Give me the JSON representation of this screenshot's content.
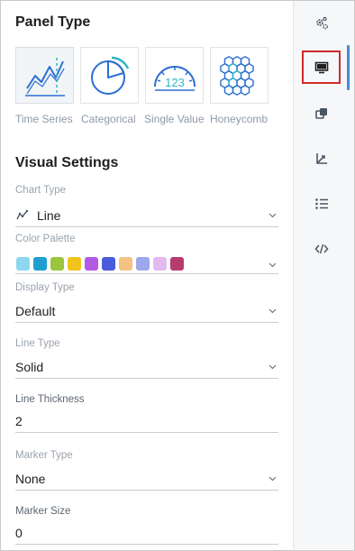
{
  "panel_type": {
    "title": "Panel Type",
    "options": [
      {
        "label": "Time Series",
        "selected": true
      },
      {
        "label": "Categorical",
        "selected": false
      },
      {
        "label": "Single Value",
        "selected": false
      },
      {
        "label": "Honeycomb",
        "selected": false
      }
    ],
    "single_value_sample": "123"
  },
  "visual_settings": {
    "title": "Visual Settings",
    "chart_type": {
      "label": "Chart Type",
      "value": "Line",
      "icon": "line-chart-icon"
    },
    "color_palette": {
      "label": "Color Palette",
      "colors": [
        "#8fd6f0",
        "#1f9fd0",
        "#9bc53d",
        "#f0c419",
        "#b15be4",
        "#4a5bdc",
        "#f6c185",
        "#9ea7ea",
        "#e4b9f0",
        "#b83b6f"
      ]
    },
    "display_type": {
      "label": "Display Type",
      "value": "Default"
    },
    "line_type": {
      "label": "Line Type",
      "value": "Solid"
    },
    "line_thickness": {
      "label": "Line Thickness",
      "value": "2"
    },
    "marker_type": {
      "label": "Marker Type",
      "value": "None"
    },
    "marker_size": {
      "label": "Marker Size",
      "value": "0"
    }
  },
  "rail": {
    "items": [
      {
        "icon": "gears-icon",
        "active": false
      },
      {
        "icon": "monitor-icon",
        "active": true
      },
      {
        "icon": "layers-icon",
        "active": false
      },
      {
        "icon": "axis-icon",
        "active": false
      },
      {
        "icon": "list-icon",
        "active": false
      },
      {
        "icon": "code-icon",
        "active": false
      }
    ]
  },
  "colors": {
    "accent": "#4a8ad4",
    "highlight": "#d12a2a",
    "icon_teal": "#2fb5c8",
    "icon_blue": "#2c6fd2"
  }
}
